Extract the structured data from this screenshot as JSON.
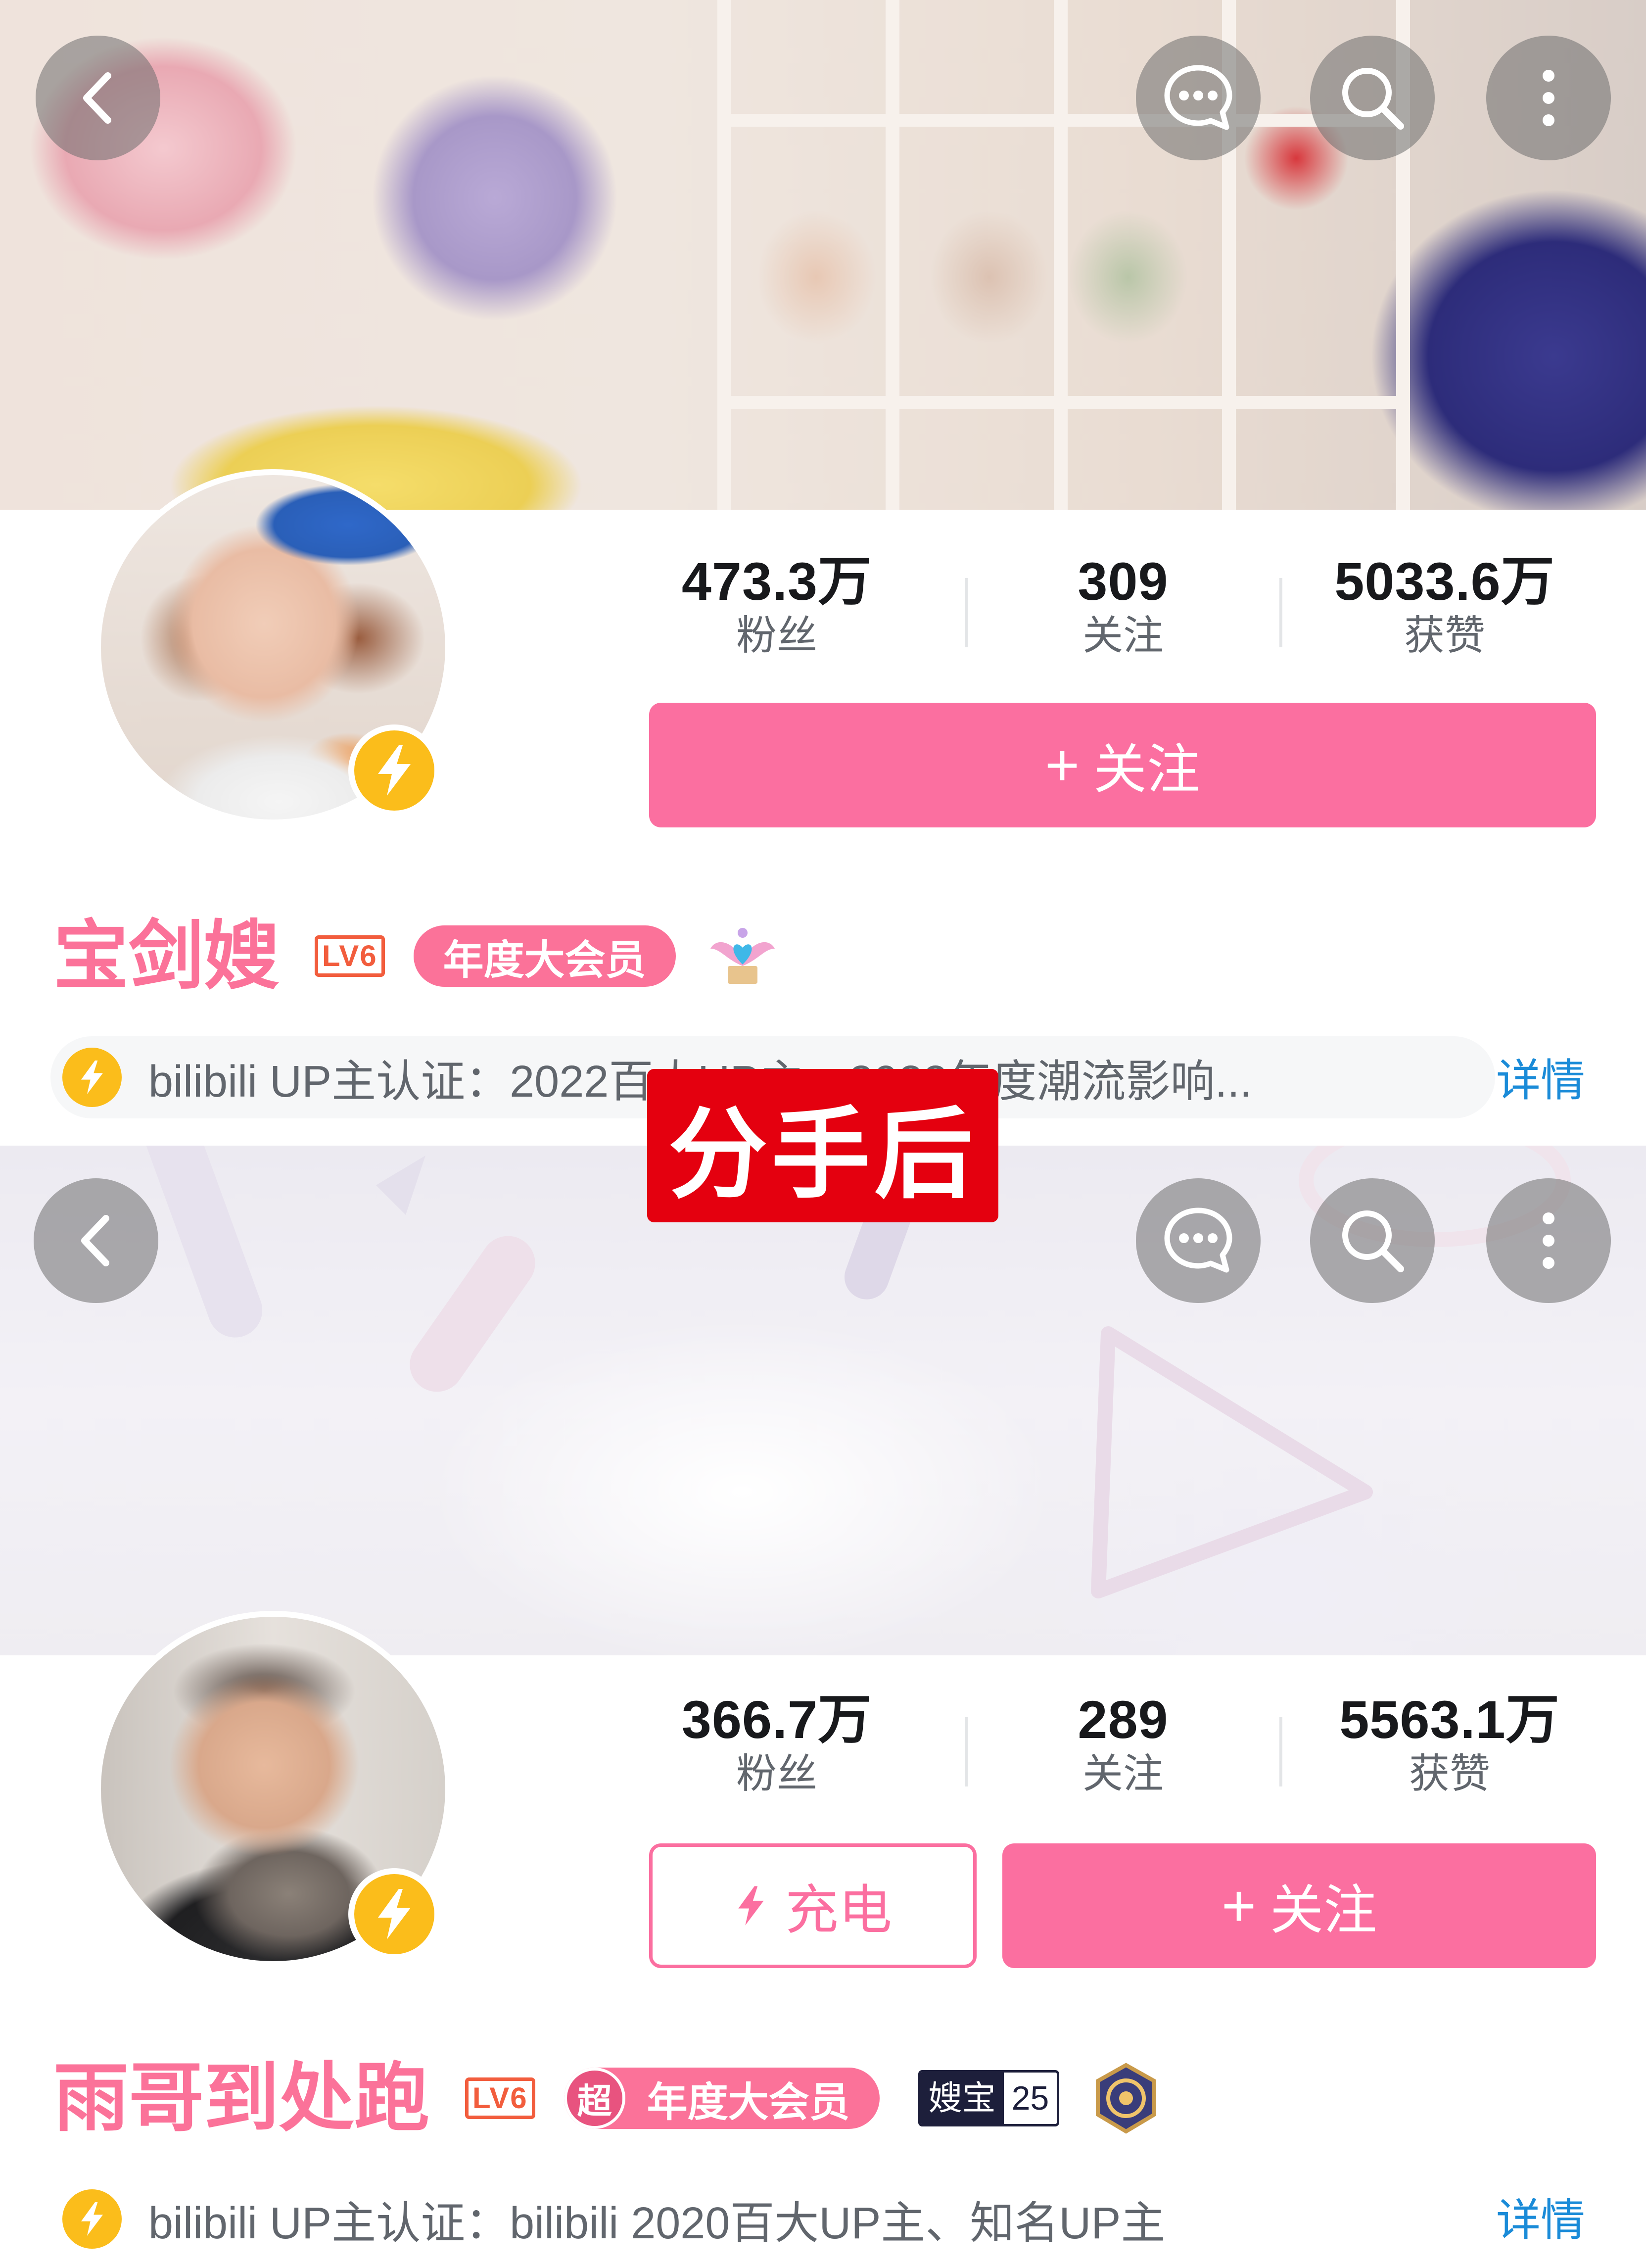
{
  "overlay_label": "分手后",
  "profiles": [
    {
      "username": "宝剑嫂",
      "level": "LV6",
      "vip_label": "年度大会员",
      "stats": {
        "followers_value": "473.3万",
        "followers_label": "粉丝",
        "following_value": "309",
        "following_label": "关注",
        "likes_value": "5033.6万",
        "likes_label": "获赞"
      },
      "follow_button_label": "关注",
      "certification": "bilibili UP主认证：2022百大UP主、2022年度潮流影响...",
      "detail_link": "详情"
    },
    {
      "username": "雨哥到处跑",
      "level": "LV6",
      "vip_prefix": "超",
      "vip_label": "年度大会员",
      "medal_name": "嫂宝",
      "medal_level": "25",
      "stats": {
        "followers_value": "366.7万",
        "followers_label": "粉丝",
        "following_value": "289",
        "following_label": "关注",
        "likes_value": "5563.1万",
        "likes_label": "获赞"
      },
      "charge_button_label": "充电",
      "follow_button_label": "关注",
      "certification": "bilibili UP主认证：bilibili 2020百大UP主、知名UP主",
      "detail_link": "详情"
    }
  ],
  "icons": {
    "back": "back-arrow-icon",
    "message": "message-icon",
    "search": "search-icon",
    "more": "more-vertical-icon",
    "bolt": "lightning-bolt-icon"
  },
  "colors": {
    "brand_pink": "#fb7299",
    "button_pink": "#fb6fa0",
    "level_orange": "#f25d3d",
    "bolt_yellow": "#fbbd1b",
    "link_blue": "#1a8bd8",
    "overlay_red": "#e4000f"
  }
}
